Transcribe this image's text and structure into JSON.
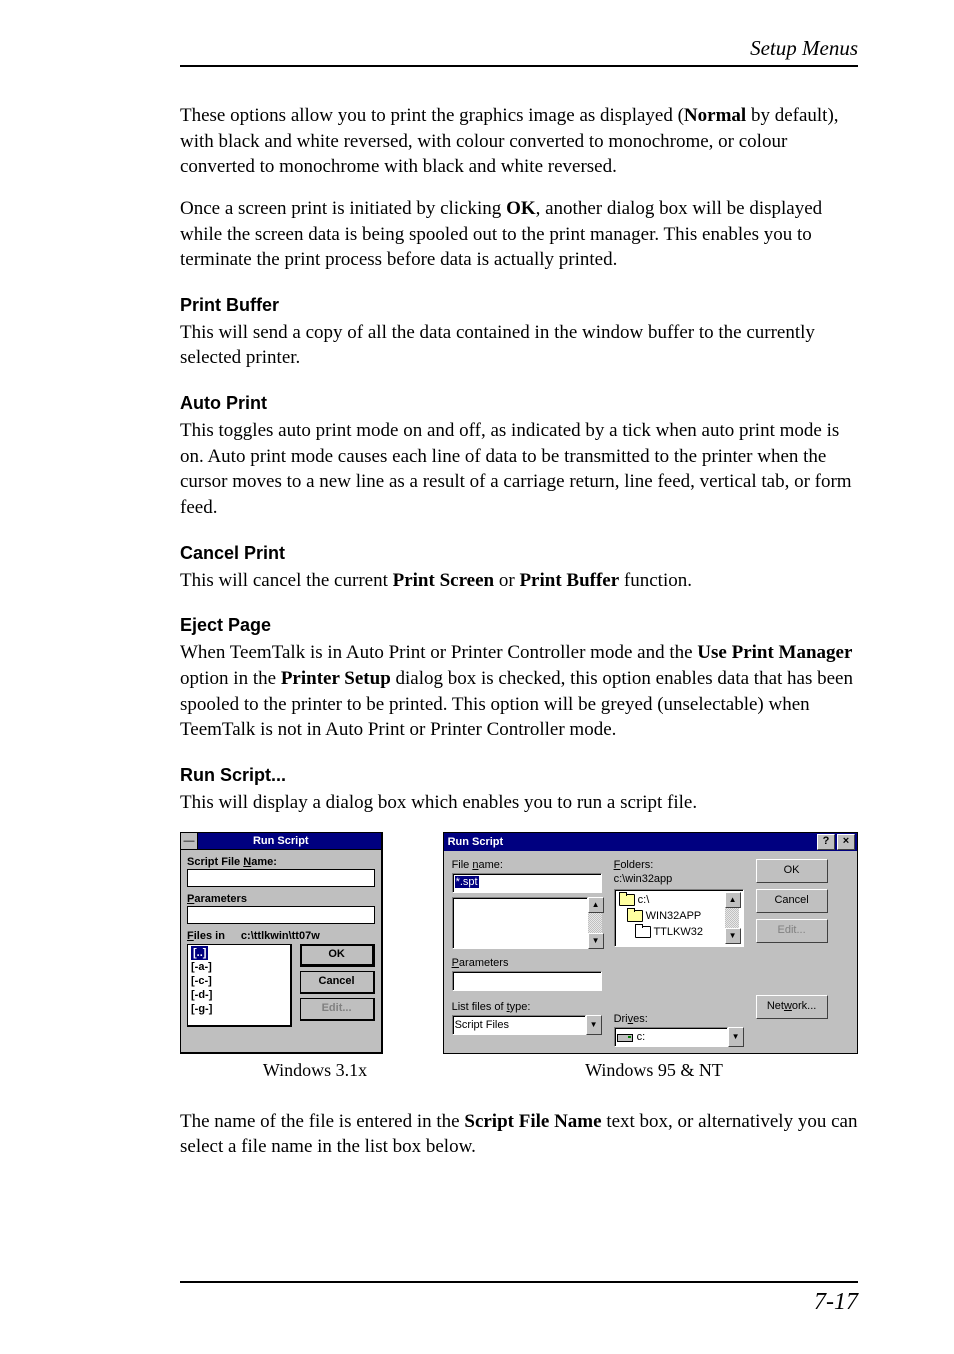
{
  "header": {
    "section_title": "Setup Menus"
  },
  "paragraphs": {
    "p1a": "These options allow you to print the graphics image as displayed (",
    "p1_bold": "Normal",
    "p1b": " by default), with black and white reversed, with colour converted to monochrome, or colour converted to monochrome with black and white reversed.",
    "p2a": "Once a screen print is initiated by clicking ",
    "p2_bold": "OK",
    "p2b": ", another dialog box will be displayed while the screen data is being spooled out to the print manager. This enables you to terminate the print process before data is actually printed."
  },
  "print_buffer": {
    "heading": "Print Buffer",
    "text": "This will send a copy of all the data contained in the window buffer to the currently selected printer."
  },
  "auto_print": {
    "heading": "Auto Print",
    "text": "This toggles auto print mode on and off, as indicated by a tick when auto print mode is on. Auto print mode causes each line of data to be transmitted to the printer when the cursor moves to a new line as a result of a carriage return, line feed, vertical tab, or form feed."
  },
  "cancel_print": {
    "heading": "Cancel Print",
    "text_a": "This will cancel the current ",
    "bold1": "Print Screen",
    "text_b": " or ",
    "bold2": "Print Buffer",
    "text_c": " function."
  },
  "eject_page": {
    "heading": "Eject Page",
    "text_a": "When TeemTalk is in Auto Print or Printer Controller mode and the ",
    "bold1": "Use Print Manager",
    "text_b": " option in the ",
    "bold2": "Printer Setup",
    "text_c": " dialog box is checked, this option enables data that has been spooled to the printer to be printed. This option will be greyed (unselectable) when TeemTalk is not in Auto Print or Printer Controller mode."
  },
  "run_script": {
    "heading": "Run Script...",
    "text": "This will display a dialog box which enables you to run a script file."
  },
  "dlg31": {
    "title": "Run Script",
    "script_file_name_label": "Script File Name:",
    "script_file_name_value": "",
    "parameters_label": "Parameters",
    "parameters_value": "",
    "files_in_label": "Files in",
    "files_in_path": "c:\\ttlkwin\\tt07w",
    "list_items": [
      "[..]",
      "[-a-]",
      "[-c-]",
      "[-d-]",
      "[-g-]"
    ],
    "ok": "OK",
    "cancel": "Cancel",
    "edit": "Edit..."
  },
  "dlg95": {
    "title": "Run Script",
    "file_name_label": "File name:",
    "file_name_value": "*.spt",
    "folders_label": "Folders:",
    "folders_path": "c:\\win32app",
    "folder_items": [
      "c:\\",
      "WIN32APP",
      "TTLKW32"
    ],
    "parameters_label": "Parameters",
    "list_files_label": "List files of type:",
    "list_files_value": "Script Files",
    "drives_label": "Drives:",
    "drives_value": "c:",
    "ok": "OK",
    "cancel": "Cancel",
    "edit": "Edit...",
    "network": "Network..."
  },
  "captions": {
    "win31": "Windows 3.1x",
    "win95": "Windows 95 & NT"
  },
  "post_text": {
    "a": "The name of the file is entered in the ",
    "b": "Script File Name",
    "c": " text box, or alternatively you can select a file name in the list box below."
  },
  "footer": {
    "page": "7-17"
  }
}
